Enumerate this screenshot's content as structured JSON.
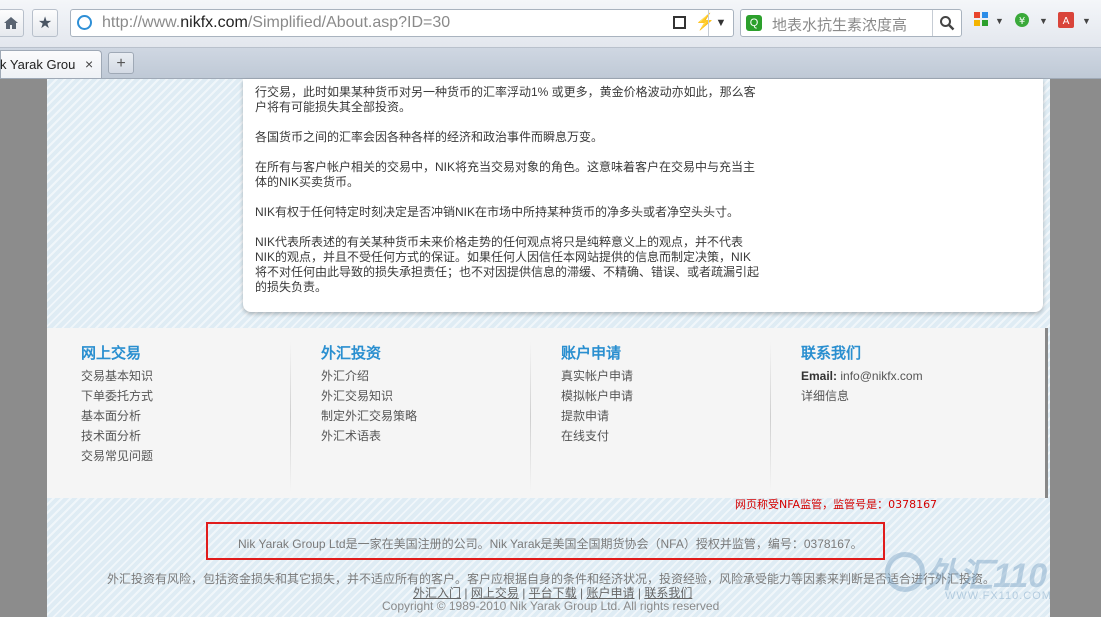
{
  "browser": {
    "url_prefix": "http://www.",
    "url_domain": "nikfx.com",
    "url_path": "/Simplified/About.asp?ID=30",
    "search_placeholder": "地表水抗生素浓度高",
    "tab_title": "k Yarak Grou",
    "tab_close": "×",
    "new_tab": "+"
  },
  "content": {
    "paragraphs": [
      "行交易，此时如果某种货币对另一种货币的汇率浮动1% 或更多，黄金价格波动亦如此，那么客户将有可能损失其全部投资。",
      "各国货币之间的汇率会因各种各样的经济和政治事件而瞬息万变。",
      "在所有与客户帐户相关的交易中，NIK将充当交易对象的角色。这意味着客户在交易中与充当主体的NIK买卖货币。",
      "NIK有权于任何特定时刻决定是否冲销NIK在市场中所持某种货币的净多头或者净空头头寸。",
      "NIK代表所表述的有关某种货币未来价格走势的任何观点将只是纯粹意义上的观点，并不代表NIK的观点，并且不受任何方式的保证。如果任何人因信任本网站提供的信息而制定决策，NIK将不对任何由此导致的损失承担责任；也不对因提供信息的滞缓、不精确、错误、或者疏漏引起的损失负责。"
    ]
  },
  "footer": {
    "columns": [
      {
        "heading": "网上交易",
        "items": [
          "交易基本知识",
          "下单委托方式",
          "基本面分析",
          "技术面分析",
          "交易常见问题"
        ]
      },
      {
        "heading": "外汇投资",
        "items": [
          "外汇介绍",
          "外汇交易知识",
          "制定外汇交易策略",
          "外汇术语表"
        ]
      },
      {
        "heading": "账户申请",
        "items": [
          "真实帐户申请",
          "模拟帐户申请",
          "提款申请",
          "在线支付"
        ]
      },
      {
        "heading": "联系我们",
        "email_label": "Email:",
        "email": "info@nikfx.com",
        "items": [
          "详细信息"
        ]
      }
    ],
    "annotation": "网页称受NFA监管，监管号是：0378167",
    "registration": "Nik Yarak Group Ltd是一家在美国注册的公司。Nik Yarak是美国全国期货协会（NFA）授权并监管，编号：0378167。",
    "risk": "外汇投资有风险，包括资金损失和其它损失，并不适应所有的客户。客户应根据自身的条件和经济状况，投资经验，风险承受能力等因素来判断是否适合进行外汇投资。",
    "links": [
      "外汇入门",
      "网上交易",
      "平台下载",
      "账户申请",
      "联系我们"
    ],
    "link_sep": "|",
    "copyright": "Copyright © 1989-2010 Nik Yarak Group Ltd. All rights reserved"
  },
  "watermark": {
    "logo_text": "外汇110",
    "site": "WWW.FX110.COM"
  }
}
